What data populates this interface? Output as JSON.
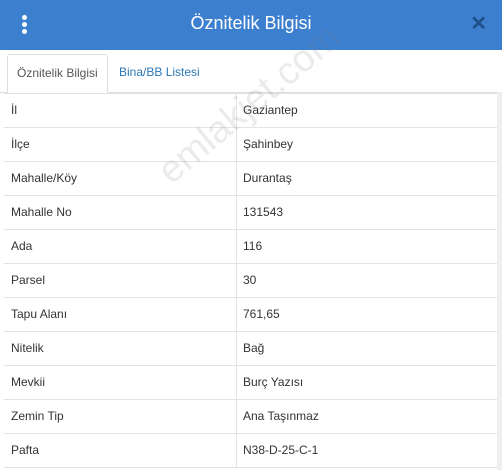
{
  "window": {
    "title": "Öznitelik Bilgisi",
    "close_glyph": "✕"
  },
  "tabs": [
    {
      "label": "Öznitelik Bilgisi",
      "active": true
    },
    {
      "label": "Bina/BB Listesi",
      "active": false
    }
  ],
  "rows": [
    {
      "label": "İl",
      "value": "Gaziantep"
    },
    {
      "label": "İlçe",
      "value": "Şahinbey"
    },
    {
      "label": "Mahalle/Köy",
      "value": "Durantaş"
    },
    {
      "label": "Mahalle No",
      "value": "131543"
    },
    {
      "label": "Ada",
      "value": "116"
    },
    {
      "label": "Parsel",
      "value": "30"
    },
    {
      "label": "Tapu Alanı",
      "value": "761,65"
    },
    {
      "label": "Nitelik",
      "value": "Bağ"
    },
    {
      "label": "Mevkii",
      "value": "Burç Yazısı"
    },
    {
      "label": "Zemin Tip",
      "value": "Ana Taşınmaz"
    },
    {
      "label": "Pafta",
      "value": "N38-D-25-C-1"
    }
  ],
  "watermark": "emlakjet.com",
  "colors": {
    "header": "#3c7fcf",
    "tab_link": "#2a78b8"
  }
}
